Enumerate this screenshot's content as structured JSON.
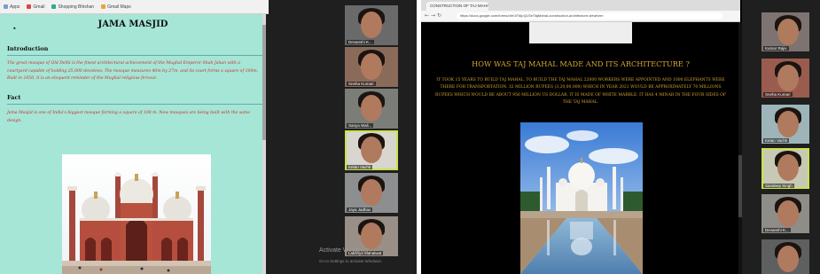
{
  "left_screen": {
    "bookmarks": [
      {
        "icon": "apps-icon",
        "label": "Apps"
      },
      {
        "icon": "mail-icon",
        "label": "Gmail"
      },
      {
        "icon": "link-icon",
        "label": "Shopping Bhishan"
      },
      {
        "icon": "link-icon",
        "label": "Gmail Maps"
      }
    ],
    "page": {
      "title": "JAMA MASJID",
      "introduction_heading": "Introduction",
      "introduction_text": "The great mosque of Old Delhi is the finest architectural achievement of the Mughal Emperor Shah Jahan with a courtyard capable of holding 25,000 devotees. The mosque measures 40m by 27m, and its court forms a square of 100m. Built in 1656, it is an eloquent reminder of the Mughal religious fervour.",
      "fact_heading": "Fact",
      "fact_text": "Jama Masjid is one of India's biggest mosque forming a square of 100 m. New mosques are being built with the same design.",
      "image_subject": "Jama Masjid mosque"
    },
    "participants": [
      {
        "name": "Devanshi K..."
      },
      {
        "name": "Sneha Kumari"
      },
      {
        "name": "Sanya Wali..."
      },
      {
        "name": "Ketan Vachh"
      },
      {
        "name": "Jaya Jadhav"
      },
      {
        "name": "Lakshya Mahalwat"
      }
    ],
    "activation": {
      "title": "Activate Windows",
      "subtitle": "Go to Settings to activate Windows."
    }
  },
  "right_screen": {
    "tab_label": "CONSTRUCTION OF TAJ MAHAL",
    "url": "https://docs.google.com/forms/d/e/1FAIpQLSe/TajMahal-construction-architecture-viewform",
    "page": {
      "heading": "HOW WAS TAJ MAHAL MADE AND ITS ARCHITECTURE ?",
      "paragraph": "IT TOOK 15 YEARS TO BUILD TAJ MAHAL. TO BUILD THE TAJ MAHAL 22000 WORKERS WERE APPOINTED AND 1000 ELEPHANTS WERE THERE FOR TRANSPORTATION. 32 MILLION RUPEES (3,20,00,000) WHICH IN YEAR 2021 WOULD BE APPROXIMATELY 70 MILLIONS RUPEES WHICH WOULD BE ABOUT 956 MILLION US DOLLAR. IT IS MADE OF WHITE MARBLE. IT HAS 4 MINAR IN THE FOUR SIDES OF THE TAJ MAHAL.",
      "image_subject": "Taj Mahal reflected in pool"
    },
    "participants": [
      {
        "name": "Kumar Rajiv"
      },
      {
        "name": "Sneha Kumari"
      },
      {
        "name": "Ketan Vachh"
      },
      {
        "name": "Sandeep Singh"
      },
      {
        "name": "Devanshi K..."
      },
      {
        "name": ""
      }
    ]
  },
  "colors": {
    "left_page_bg": "#a5e6d6",
    "left_text_red": "#cc2d2d",
    "right_page_bg": "#000000",
    "right_text_gold": "#d6a437",
    "active_speaker_border": "#c9e34e"
  }
}
